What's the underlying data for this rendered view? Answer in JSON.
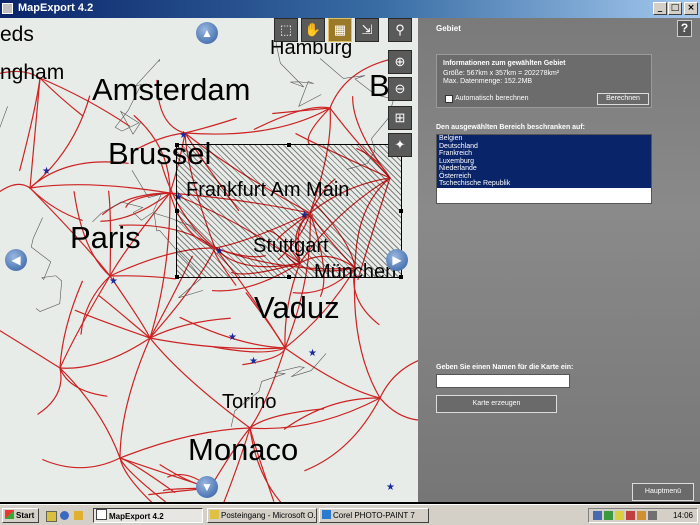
{
  "window": {
    "title": "MapExport 4.2",
    "min_glyph": "_",
    "max_glyph": "□",
    "close_glyph": "×"
  },
  "map": {
    "cities": [
      {
        "name": "edsord",
        "text": "eds"
      },
      {
        "name": "ngham",
        "text": "ngham"
      },
      {
        "name": "hamburg",
        "text": "Hamburg"
      },
      {
        "name": "amsterdam",
        "text": "Amsterdam"
      },
      {
        "name": "b-partial",
        "text": "B"
      },
      {
        "name": "brussel",
        "text": "Brussel"
      },
      {
        "name": "frankfurt",
        "text": "Frankfurt Am Main"
      },
      {
        "name": "paris",
        "text": "Paris"
      },
      {
        "name": "stuttgart",
        "text": "Stuttgart"
      },
      {
        "name": "munchen",
        "text": "München"
      },
      {
        "name": "vaduz",
        "text": "Vaduz"
      },
      {
        "name": "torino",
        "text": "Torino"
      },
      {
        "name": "monaco",
        "text": "Monaco"
      }
    ],
    "tools": {
      "select_zoom_icon": "zoom-select-icon",
      "pan_icon": "hand-pan-icon",
      "area_select_icon": "area-select-icon",
      "move_icon": "move-icon",
      "info_icon": "magnifier-info-icon",
      "zoom_in_icon": "zoom-in-icon",
      "zoom_out_icon": "zoom-out-icon",
      "zoom_area_icon": "zoom-area-icon",
      "overview_icon": "europe-overview-icon"
    },
    "road_color": "#cc2222",
    "accent_color": "#1a2aa0"
  },
  "panel": {
    "section_title": "Gebiet",
    "help_label": "?",
    "info_title": "Informationen zum gewählten Gebiet",
    "size_text": "Größe: 567km x 357km = 202278km²",
    "data_text": "Max. Datenmenge: 152.2MB",
    "auto_calc_label": "Automatisch berechnen",
    "calc_button": "Berechnen",
    "restrict_title": "Den ausgewählten Bereich beschranken auf:",
    "countries": [
      "Belgien",
      "Deutschland",
      "Frankreich",
      "Luxemburg",
      "Niederlande",
      "Österreich",
      "Tschechische Republik"
    ],
    "name_prompt": "Geben Sie einen Namen für die Karte ein:",
    "name_value": "",
    "create_button": "Karte erzeugen",
    "main_menu_button": "Hauptmenü"
  },
  "taskbar": {
    "start_label": "Start",
    "tasks": [
      {
        "label": "MapExport 4.2",
        "active": true
      },
      {
        "label": "Posteingang - Microsoft O...",
        "active": false
      },
      {
        "label": "Corel PHOTO-PAINT 7",
        "active": false
      }
    ],
    "clock": "14:06"
  }
}
